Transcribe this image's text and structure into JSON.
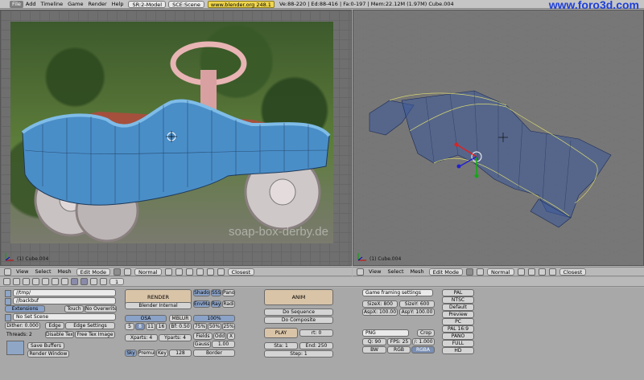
{
  "topbar": {
    "menus": [
      "File",
      "Add",
      "Timeline",
      "Game",
      "Render",
      "Help"
    ],
    "screen": "SR:2-Model",
    "scene": "SCE:Scene",
    "url": "www.blender.org 248.1",
    "stats": "Ve:88-220 | Ed:88-416 | Fa:0-197 | Mem:22.12M (1.97M) Cube.004"
  },
  "watermark": "www.foro3d.com",
  "left_view": {
    "object_label": "(1) Cube.004",
    "photo_text": "soap-box-derby.de"
  },
  "right_view": {
    "object_label": "(1) Cube.004"
  },
  "view_header": {
    "menus": [
      "View",
      "Select",
      "Mesh"
    ],
    "mode": "Edit Mode",
    "pivot": "Normal",
    "snap": "Closest"
  },
  "buttons_header": {
    "frame": "1"
  },
  "output": {
    "path1": "//tmp/",
    "path2": "//backbuf",
    "extensions": "Extensions",
    "touch": "Touch",
    "no_overwrite": "No Overwrite",
    "no_set_scene": "No Set Scene",
    "dither": "Dither: 0.000",
    "edge": "Edge",
    "edge_settings": "Edge Settings",
    "threads": "Threads: 2",
    "disable_tex": "Disable Tex",
    "free_tex_image": "Free Tex Image",
    "save_buffers": "Save Buffers",
    "render_window": "Render Window"
  },
  "render": {
    "render": "RENDER",
    "engine": "Blender Internal",
    "shadow": "Shado",
    "sss": "SSS",
    "pano": "Pano",
    "envmap": "EnvMa",
    "ray": "Ray",
    "radio": "Radi",
    "osa": "OSA",
    "osa_values": [
      "5",
      "8",
      "11",
      "16"
    ],
    "mblur": "MBLUR",
    "bf": "Bf: 0.50",
    "percent100": "100%",
    "percent_values": [
      "75%",
      "50%",
      "25%"
    ],
    "xparts": "Xparts: 4",
    "yparts": "Yparts: 4",
    "fields": "Fields",
    "odd": "Odd",
    "x": "X",
    "gauss": "Gauss",
    "gauss_value": "1.00",
    "sky": "Sky",
    "premul": "Premul",
    "key": "Key",
    "val128": "128",
    "border": "Border"
  },
  "anim": {
    "anim": "ANIM",
    "do_sequence": "Do Sequence",
    "do_composite": "Do Composite",
    "play": "PLAY",
    "rt": "rt: 0",
    "sta": "Sta: 1",
    "end": "End: 250",
    "step": "Step: 1"
  },
  "format": {
    "framing": "Game framing settings",
    "sizex": "SizeX: 800",
    "sizey": "SizeY: 600",
    "aspx": "AspX: 100.00",
    "aspy": "AspY: 100.00",
    "png": "PNG",
    "crop": "Crop",
    "q": "Q: 90",
    "fps": "FPS: 25",
    "fps_div": "/: 1.000",
    "bw": "BW",
    "rgb": "RGB",
    "rgba": "RGBA"
  },
  "presets": [
    "PAL",
    "NTSC",
    "Default",
    "Preview",
    "PC",
    "PAL 16:9",
    "PANO",
    "FULL",
    "HD"
  ]
}
